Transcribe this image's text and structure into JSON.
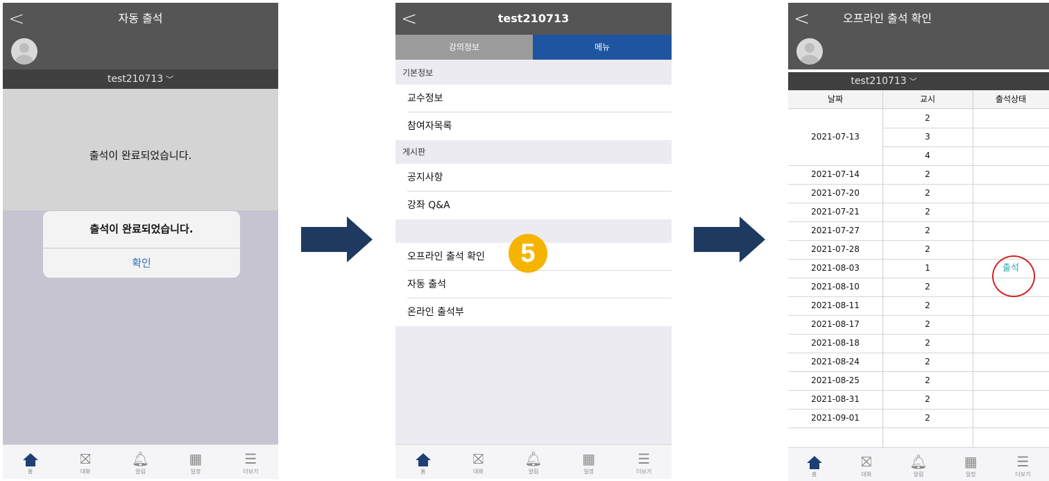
{
  "colors": {
    "header_gray": "#555555",
    "userbar_gray": "#404040",
    "menu_blue": "#1f55a0",
    "inactive_tab": "#9b9b9b",
    "arrow_navy": "#1e3a60",
    "badge_yellow": "#f5b400",
    "highlight_red": "#d32222",
    "attend_teal": "#27a6b8"
  },
  "tabbar": [
    {
      "label": "홈",
      "icon": "home-icon"
    },
    {
      "label": "대화",
      "icon": "chat-icon"
    },
    {
      "label": "알림",
      "icon": "bell-icon"
    },
    {
      "label": "일정",
      "icon": "calendar-icon"
    },
    {
      "label": "더보기",
      "icon": "menu-icon"
    }
  ],
  "screen1": {
    "title": "자동 출석",
    "username": "test210713",
    "message": "출석이 완료되었습니다.",
    "dialog": {
      "message": "출석이 완료되었습니다.",
      "button": "확인"
    }
  },
  "screen2": {
    "title": "test210713",
    "tabs": [
      "강의정보",
      "메뉴"
    ],
    "section_basic": "기본정보",
    "basic_items": [
      "교수정보",
      "참여자목록"
    ],
    "section_board": "게시판",
    "board_items": [
      "공지사항",
      "강좌 Q&A"
    ],
    "attendance_items": [
      "오프라인 출석 확인",
      "자동 출석",
      "온라인 출석부"
    ],
    "badge": "5"
  },
  "screen3": {
    "title": "오프라인 출석 확인",
    "username": "test210713",
    "headers": [
      "날짜",
      "교시",
      "출석상태"
    ],
    "group_date": "2021-07-13",
    "group_periods": [
      "2",
      "3",
      "4"
    ],
    "rows": [
      {
        "date": "2021-07-14",
        "period": "2",
        "status": ""
      },
      {
        "date": "2021-07-20",
        "period": "2",
        "status": ""
      },
      {
        "date": "2021-07-21",
        "period": "2",
        "status": ""
      },
      {
        "date": "2021-07-27",
        "period": "2",
        "status": ""
      },
      {
        "date": "2021-07-28",
        "period": "2",
        "status": ""
      },
      {
        "date": "2021-08-03",
        "period": "1",
        "status": "출석"
      },
      {
        "date": "2021-08-10",
        "period": "2",
        "status": ""
      },
      {
        "date": "2021-08-11",
        "period": "2",
        "status": ""
      },
      {
        "date": "2021-08-17",
        "period": "2",
        "status": ""
      },
      {
        "date": "2021-08-18",
        "period": "2",
        "status": ""
      },
      {
        "date": "2021-08-24",
        "period": "2",
        "status": ""
      },
      {
        "date": "2021-08-25",
        "period": "2",
        "status": ""
      },
      {
        "date": "2021-08-31",
        "period": "2",
        "status": ""
      },
      {
        "date": "2021-09-01",
        "period": "2",
        "status": ""
      }
    ]
  }
}
